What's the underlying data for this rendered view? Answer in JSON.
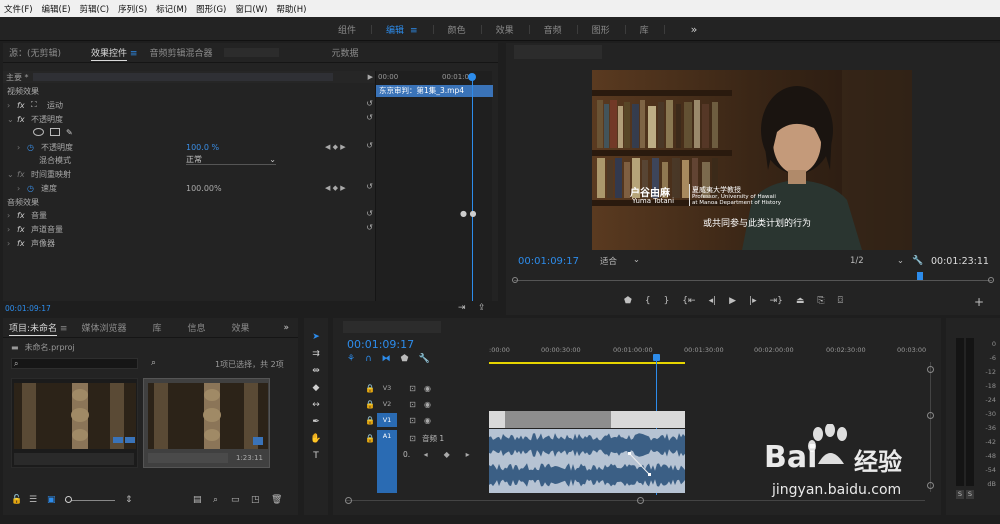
{
  "menu": [
    "文件(F)",
    "编辑(E)",
    "剪辑(C)",
    "序列(S)",
    "标记(M)",
    "图形(G)",
    "窗口(W)",
    "帮助(H)"
  ],
  "workspace": {
    "tabs": [
      "组件",
      "编辑",
      "颜色",
      "效果",
      "音频",
      "图形",
      "库"
    ],
    "active": "编辑",
    "overflow": "»"
  },
  "effect_controls": {
    "tabs": [
      "源：(无剪辑)",
      "效果控件",
      "音频剪辑混合器",
      "元数据"
    ],
    "master_label": "主要 *",
    "clip_name": "东京审判：第1集_3.mp4",
    "mini_ruler": [
      "00:00",
      "00:01:00"
    ],
    "sections": {
      "video": "视频效果",
      "audio": "音频效果"
    },
    "rows": {
      "motion": "运动",
      "opacity": "不透明度",
      "opacity_prop": "不透明度",
      "opacity_value": "100.0 %",
      "blend_mode": "混合模式",
      "blend_value": "正常",
      "time_remap": "时间重映射",
      "speed": "速度",
      "speed_value": "100.00%",
      "volume": "音量",
      "channel_volume": "声道音量",
      "panner": "声像器"
    },
    "fx": "fx",
    "timecode": "00:01:09:17"
  },
  "program_monitor": {
    "timecode": "00:01:09:17",
    "fit": "适合",
    "resolution": "1/2",
    "duration": "00:01:23:11",
    "subtitle": {
      "name_cn": "户谷由麻",
      "name_en": "Yuma Totani",
      "title_cn": "夏威夷大学教授",
      "title_en_1": "Professor, University of Hawaii",
      "title_en_2": "at Manoa Department of History",
      "caption": "或共同参与此类计划的行为"
    },
    "playhead_fraction": 0.85
  },
  "project": {
    "tabs": [
      "项目:未命名",
      "媒体浏览器",
      "库",
      "信息",
      "效果"
    ],
    "file": "未命名.prproj",
    "selection": "1项已选择，共 2项",
    "thumb2_duration": "1:23:11"
  },
  "timeline": {
    "timecode": "00:01:09:17",
    "ruler": [
      ":00:00",
      "00:00:30:00",
      "00:01:00:00",
      "00:01:30:00",
      "00:02:00:00",
      "00:02:30:00",
      "00:03:00"
    ],
    "tracks": [
      "V3",
      "V2",
      "V1",
      "A1"
    ],
    "audio_track_name": "音频 1",
    "volume_value": "0.",
    "playhead_label": "00:01:09:17"
  },
  "meter": {
    "labels": [
      "0",
      "-6",
      "-12",
      "-18",
      "-24",
      "-30",
      "-36",
      "-42",
      "-48",
      "-54",
      "dB"
    ],
    "solo": [
      "S",
      "S"
    ]
  },
  "watermark": {
    "brand": "Bai",
    "brand_cn": "经验",
    "url": "jingyan.baidu.com"
  },
  "colors": {
    "accent": "#2d8ceb",
    "workarea": "#e6d400"
  }
}
